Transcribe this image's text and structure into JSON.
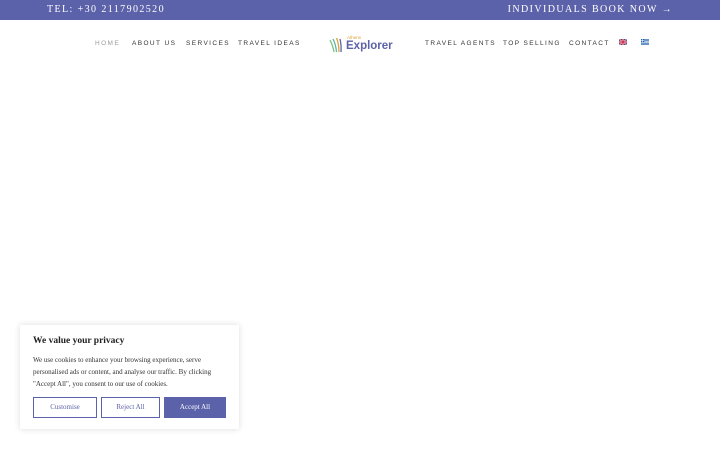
{
  "topbar": {
    "tel": "TEL: +30 2117902520",
    "book": "INDIVIDUALS BOOK NOW →"
  },
  "nav": {
    "items": [
      {
        "label": "HOME"
      },
      {
        "label": "ABOUT US"
      },
      {
        "label": "SERVICES"
      },
      {
        "label": "TRAVEL IDEAS"
      },
      {
        "label": "TRAVEL AGENTS"
      },
      {
        "label": "TOP SELLING"
      },
      {
        "label": "CONTACT"
      }
    ]
  },
  "logo": {
    "small": "Athens",
    "big": "Explorer",
    "icon": "leaf-stripes-icon"
  },
  "flags": [
    {
      "icon": "uk-flag-icon"
    },
    {
      "icon": "greek-flag-icon"
    }
  ],
  "cookie": {
    "title": "We value your privacy",
    "text": "We use cookies to enhance your browsing experience, serve personalised ads or content, and analyse our traffic. By clicking \"Accept All\", you consent to our use of cookies.",
    "customise": "Customise",
    "reject": "Reject All",
    "accept": "Accept All"
  },
  "colors": {
    "brand": "#5c62a9",
    "accent": "#d9a53a",
    "leaf": "#7cc47a"
  }
}
